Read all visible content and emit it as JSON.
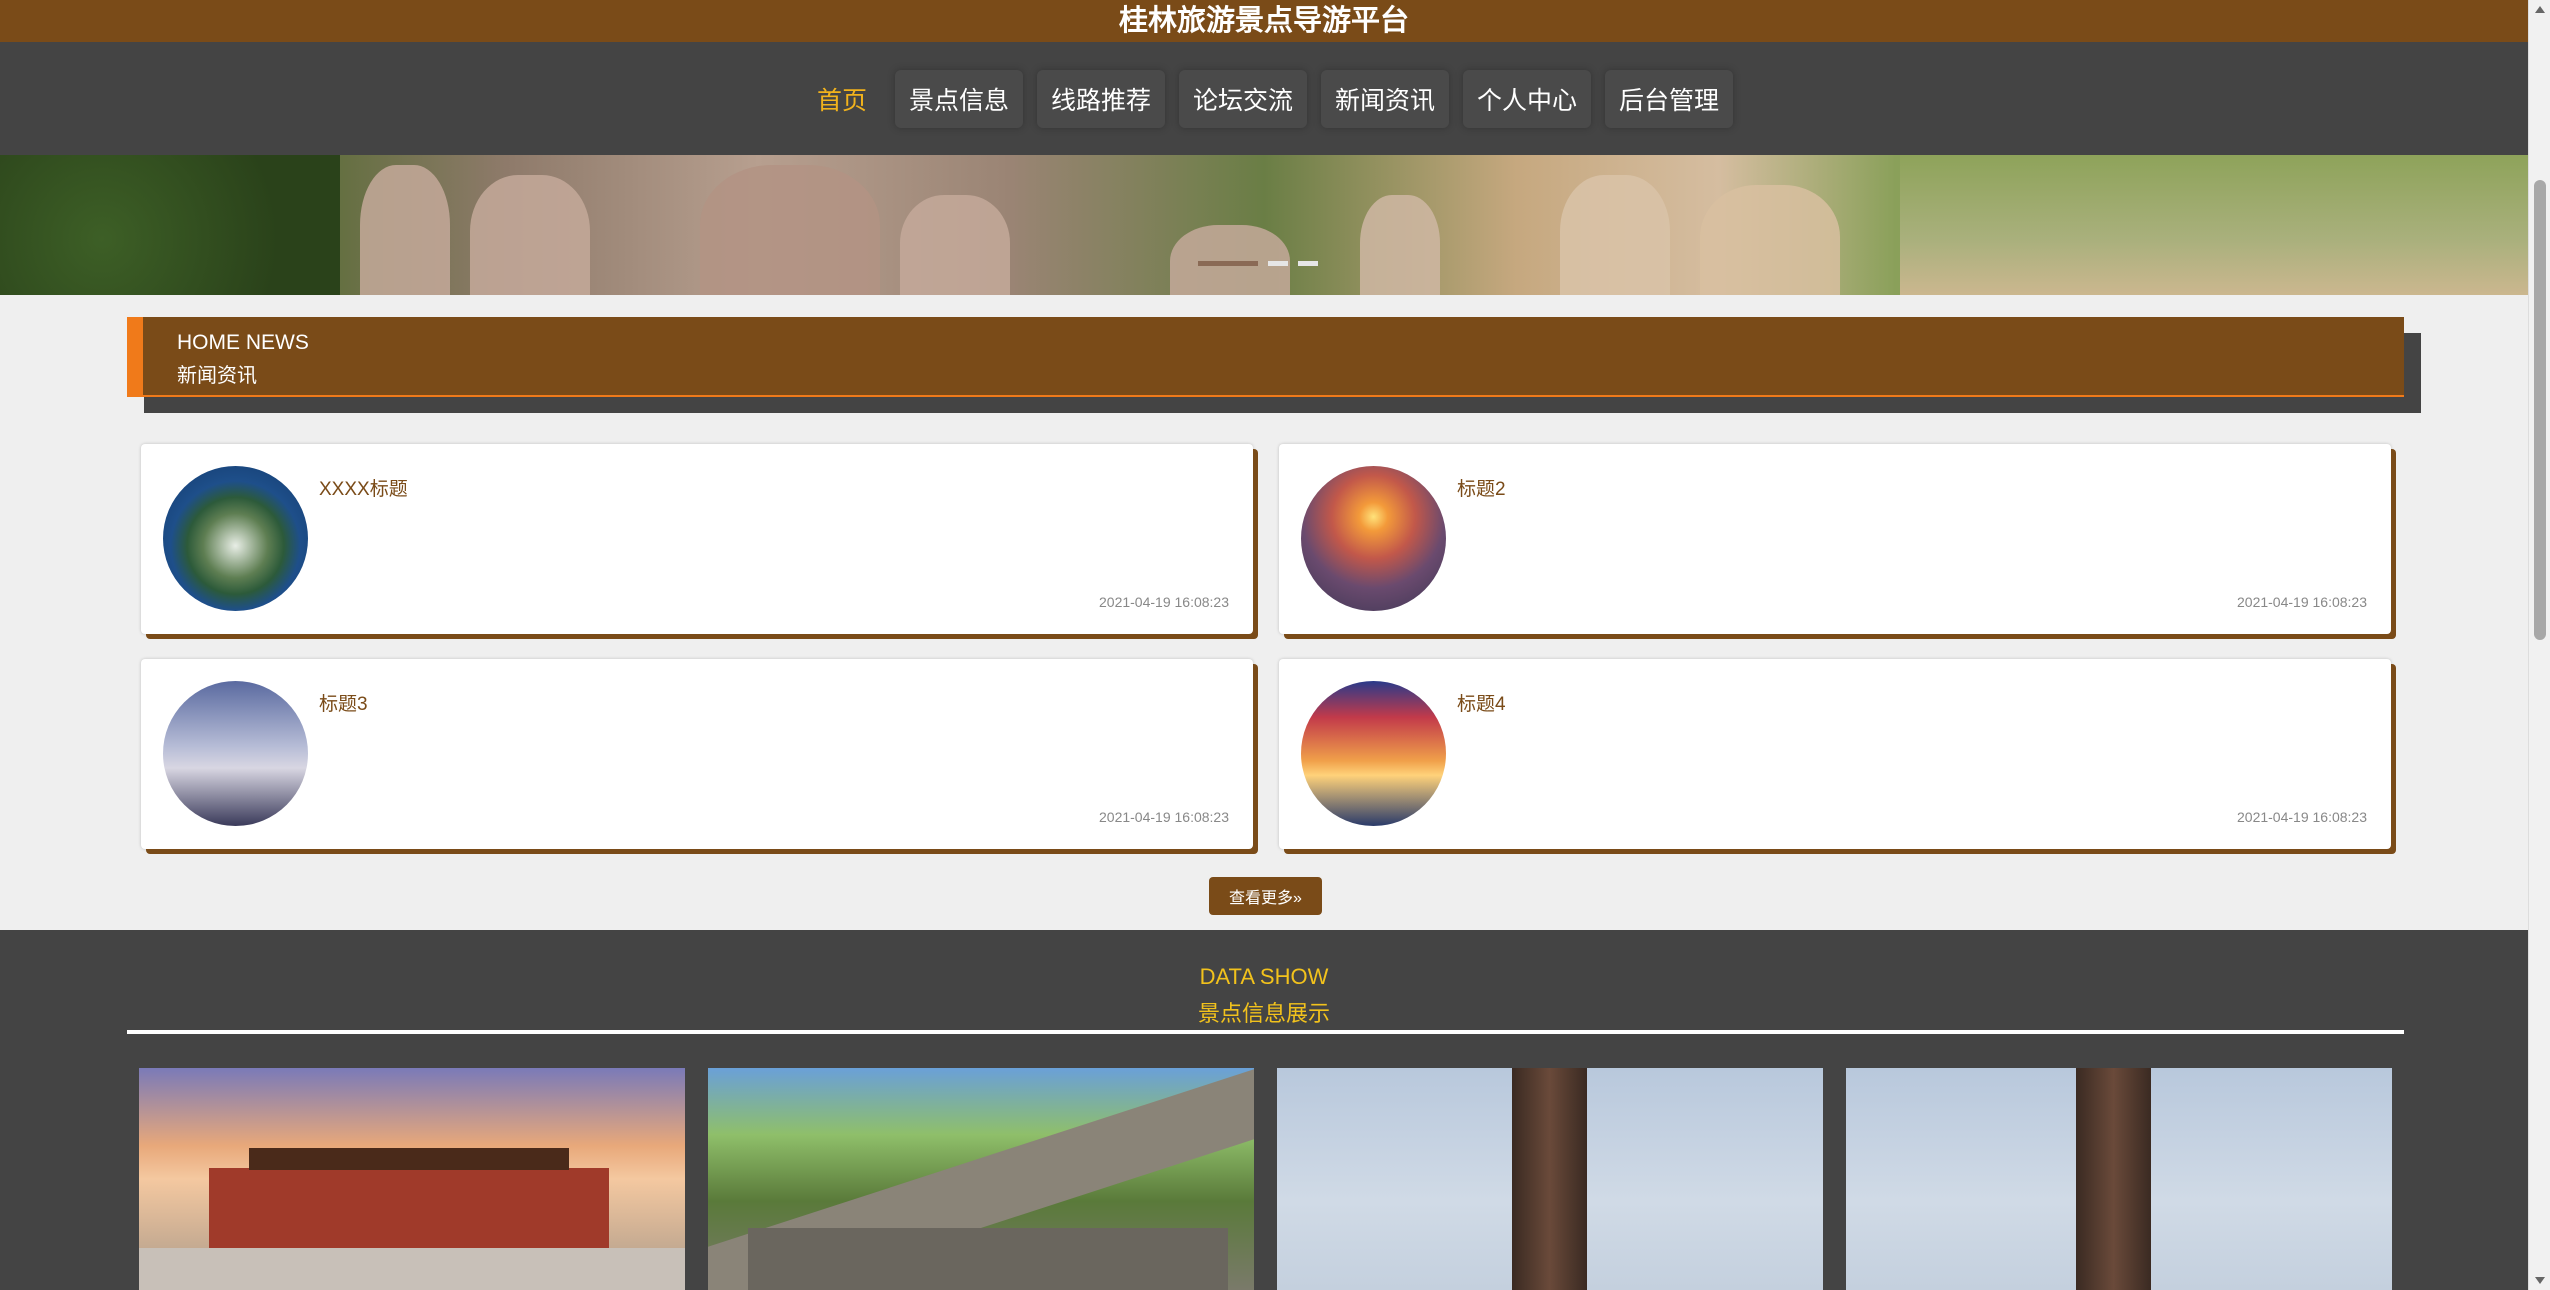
{
  "site": {
    "title": "桂林旅游景点导游平台"
  },
  "nav": {
    "items": [
      {
        "label": "首页",
        "active": true
      },
      {
        "label": "景点信息",
        "active": false
      },
      {
        "label": "线路推荐",
        "active": false
      },
      {
        "label": "论坛交流",
        "active": false
      },
      {
        "label": "新闻资讯",
        "active": false
      },
      {
        "label": "个人中心",
        "active": false
      },
      {
        "label": "后台管理",
        "active": false
      }
    ]
  },
  "news": {
    "heading_en": "HOME NEWS",
    "heading_cn": "新闻资讯",
    "items": [
      {
        "title": "XXXX标题",
        "date": "2021-04-19 16:08:23"
      },
      {
        "title": "标题2",
        "date": "2021-04-19 16:08:23"
      },
      {
        "title": "标题3",
        "date": "2021-04-19 16:08:23"
      },
      {
        "title": "标题4",
        "date": "2021-04-19 16:08:23"
      }
    ],
    "more_label": "查看更多»"
  },
  "data_show": {
    "heading_en": "DATA SHOW",
    "heading_cn": "景点信息展示"
  },
  "colors": {
    "brand_brown": "#7a4b18",
    "nav_bg": "#444444",
    "accent_yellow": "#f2b31c",
    "accent_orange": "#f07a1a"
  }
}
